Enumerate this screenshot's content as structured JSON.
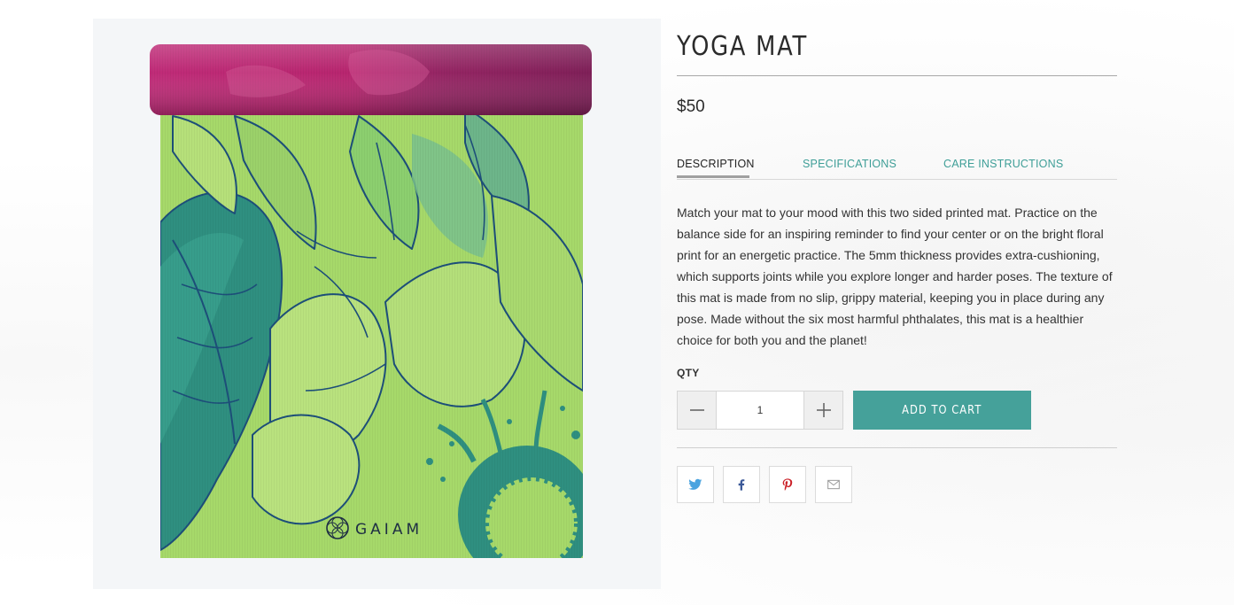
{
  "product": {
    "title": "YOGA MAT",
    "price": "$50",
    "image_alt": "Gaiam printed yoga mat, green floral print with pink rolled top",
    "image_brand_text": "GAIAM"
  },
  "tabs": [
    {
      "label": "DESCRIPTION",
      "active": true
    },
    {
      "label": "SPECIFICATIONS",
      "active": false
    },
    {
      "label": "CARE INSTRUCTIONS",
      "active": false
    }
  ],
  "description": "Match your mat to your mood with this two sided printed mat. Practice on the balance side for an inspiring reminder to find your center or on the bright floral print for an energetic practice. The 5mm thickness provides extra-cushioning, which supports joints while you explore longer and harder poses. The texture of this mat is made from no slip, grippy material, keeping you in place during any pose. Made without the six most harmful phthalates, this mat is a healthier choice for both you and the planet!",
  "quantity": {
    "label": "QTY",
    "value": "1",
    "decrement_icon": "minus-icon",
    "increment_icon": "plus-icon"
  },
  "cart": {
    "add_label": "ADD TO CART"
  },
  "share": [
    {
      "name": "twitter",
      "icon": "twitter-icon",
      "color": "#4aa3df"
    },
    {
      "name": "facebook",
      "icon": "facebook-icon",
      "color": "#3b5998"
    },
    {
      "name": "pinterest",
      "icon": "pinterest-icon",
      "color": "#cb2027"
    },
    {
      "name": "email",
      "icon": "email-icon",
      "color": "#9a9a9a"
    }
  ],
  "colors": {
    "accent": "#45a19a",
    "tab_link": "#3e9e97",
    "text": "#333333",
    "mat_green": "#a6d96a",
    "mat_teal": "#2e8f80",
    "mat_roll_pink": "#b4246f",
    "mat_roll_plum": "#8a2262"
  }
}
